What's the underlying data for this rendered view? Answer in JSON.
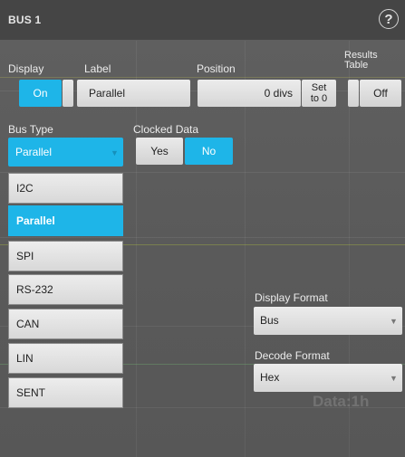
{
  "window": {
    "title": "BUS 1",
    "help_icon": "question-circle-icon",
    "help_glyph": "?"
  },
  "display": {
    "label": "Display",
    "state": "On"
  },
  "label_field": {
    "label": "Label",
    "value": "Parallel"
  },
  "position": {
    "label": "Position",
    "value": "0 divs",
    "set_zero_line1": "Set",
    "set_zero_line2": "to 0"
  },
  "results_table": {
    "label_line1": "Results",
    "label_line2": "Table",
    "state": "Off"
  },
  "bus_type": {
    "label": "Bus Type",
    "selected": "Parallel",
    "options": [
      "I2C",
      "Parallel",
      "SPI",
      "RS-232",
      "CAN",
      "LIN",
      "SENT"
    ]
  },
  "clocked_data": {
    "label": "Clocked Data",
    "yes": "Yes",
    "no": "No",
    "selected": "No"
  },
  "display_format": {
    "label": "Display Format",
    "value": "Bus"
  },
  "decode_format": {
    "label": "Decode Format",
    "value": "Hex"
  },
  "background_readout": "Data:1h",
  "colors": {
    "accent": "#1eb5e8",
    "panel": "#5a5a5a",
    "titlebar": "#454545"
  }
}
